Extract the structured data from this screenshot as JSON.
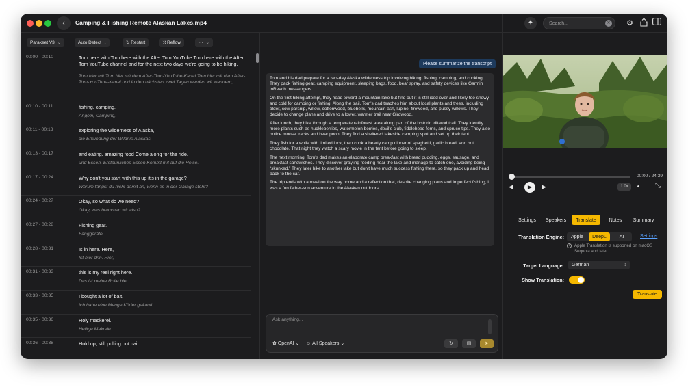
{
  "window": {
    "title": "Camping & Fishing Remote Alaskan Lakes.mp4"
  },
  "search": {
    "placeholder": "Search..."
  },
  "toolbar": {
    "model": "Parakeet V3",
    "language": "Auto Detect",
    "restart_label": "Restart",
    "reflow_label": "Reflow",
    "more_label": "···"
  },
  "transcript": [
    {
      "time": "00:00 - 00:10",
      "text": "Tom here with Tom here with the After Tom YouTube Tom here with the After Tom YouTube channel and for the next two days we're going to be hiking,",
      "translation": "Tom hier mit Tom hier mit dem After-Tom-YouTube-Kanal Tom hier mit dem After-Tom-YouTube-Kanal und in den nächsten zwei Tagen werden wir wandern,"
    },
    {
      "time": "00:10 - 00:11",
      "text": "fishing, camping,",
      "translation": "Angeln, Camping,"
    },
    {
      "time": "00:11 - 00:13",
      "text": "exploring the wilderness of Alaska,",
      "translation": "die Erkundung der Wildnis Alaskas,"
    },
    {
      "time": "00:13 - 00:17",
      "text": "and eating. amazing food Come along for the ride.",
      "translation": "und Essen. Erstaunliches Essen Kommt mit auf die Reise."
    },
    {
      "time": "00:17 - 00:24",
      "text": "Why don't you start with this up it's in the garage?",
      "translation": "Warum fängst du nicht damit an, wenn es in der Garage steht?"
    },
    {
      "time": "00:24 - 00:27",
      "text": "Okay, so what do we need?",
      "translation": "Okay, was brauchen wir also?"
    },
    {
      "time": "00:27 - 00:28",
      "text": "Fishing gear.",
      "translation": "Fanggeräte."
    },
    {
      "time": "00:28 - 00:31",
      "text": "Is in here. Here,",
      "translation": "Ist hier drin. Hier,"
    },
    {
      "time": "00:31 - 00:33",
      "text": "this is my reel right here.",
      "translation": "Das ist meine Rolle hier."
    },
    {
      "time": "00:33 - 00:35",
      "text": "I bought a lot of bait.",
      "translation": "Ich habe eine Menge Köder gekauft."
    },
    {
      "time": "00:35 - 00:36",
      "text": "Holy mackerel.",
      "translation": "Heilige Makrele."
    },
    {
      "time": "00:36 - 00:38",
      "text": "Hold up, still pulling out bait.",
      "translation": ""
    }
  ],
  "chat": {
    "user_message": "Please summarize the transcript",
    "answer_paragraphs": [
      "Tom and his dad prepare for a two-day Alaska wilderness trip involving hiking, fishing, camping, and cooking. They pack fishing gear, camping equipment, sleeping bags, food, bear spray, and safety devices like Garmin inReach messengers.",
      "On the first hiking attempt, they head toward a mountain lake but find out it is still iced over and likely too snowy and cold for camping or fishing. Along the trail, Tom's dad teaches him about local plants and trees, including alder, cow parsnip, willow, cottonwood, bluebells, mountain ash, lupine, fireweed, and pussy willows. They decide to change plans and drive to a lower, warmer trail near Girdwood.",
      "After lunch, they hike through a temperate rainforest area along part of the historic Iditarod trail. They identify more plants such as huckleberries, watermelon berries, devil's club, fiddlehead ferns, and spruce tips. They also notice moose tracks and bear poop. They find a sheltered lakeside camping spot and set up their tent.",
      "They fish for a while with limited luck, then cook a hearty camp dinner of spaghetti, garlic bread, and hot chocolate. That night they watch a scary movie in the tent before going to sleep.",
      "The next morning, Tom's dad makes an elaborate camp breakfast with bread pudding, eggs, sausage, and breakfast sandwiches. They discover grayling feeding near the lake and manage to catch one, avoiding being “skunked.” They later hike to another lake but don't have much success fishing there, so they pack up and head back to the car.",
      "The trip ends with a meal on the way home and a reflection that, despite changing plans and imperfect fishing, it was a fun father-son adventure in the Alaskan outdoors."
    ],
    "input_placeholder": "Ask anything...",
    "provider": "OpenAI",
    "speakers": "All Speakers"
  },
  "player": {
    "time": "00:00 / 24:39",
    "speed": "1.0x",
    "progress": 0.0
  },
  "tabs": [
    "Settings",
    "Speakers",
    "Translate",
    "Notes",
    "Summary"
  ],
  "active_tab": "Translate",
  "translate": {
    "engine_label": "Translation Engine:",
    "engines": [
      "Apple",
      "DeepL",
      "AI"
    ],
    "active_engine": "DeepL",
    "settings_link": "Settings",
    "info_note": "Apple Translation is supported on macOS Sequoia and later.",
    "target_label": "Target Language:",
    "target_value": "German",
    "show_label": "Show Translation:",
    "show_enabled": true,
    "button": "Translate"
  },
  "colors": {
    "accent": "#f5b800",
    "background": "#1c1c1e",
    "panel": "#2c2c2e",
    "link": "#5aa2ff"
  },
  "icons": [
    "back-chevron-icon",
    "sparkle-icon",
    "gear-icon",
    "share-icon",
    "sidebar-icon",
    "restart-icon",
    "reflow-icon",
    "play-icon",
    "rewind-icon",
    "forward-icon",
    "volume-icon",
    "expand-icon",
    "info-icon",
    "refresh-icon",
    "caption-icon",
    "send-icon",
    "openai-icon",
    "person-icon"
  ]
}
